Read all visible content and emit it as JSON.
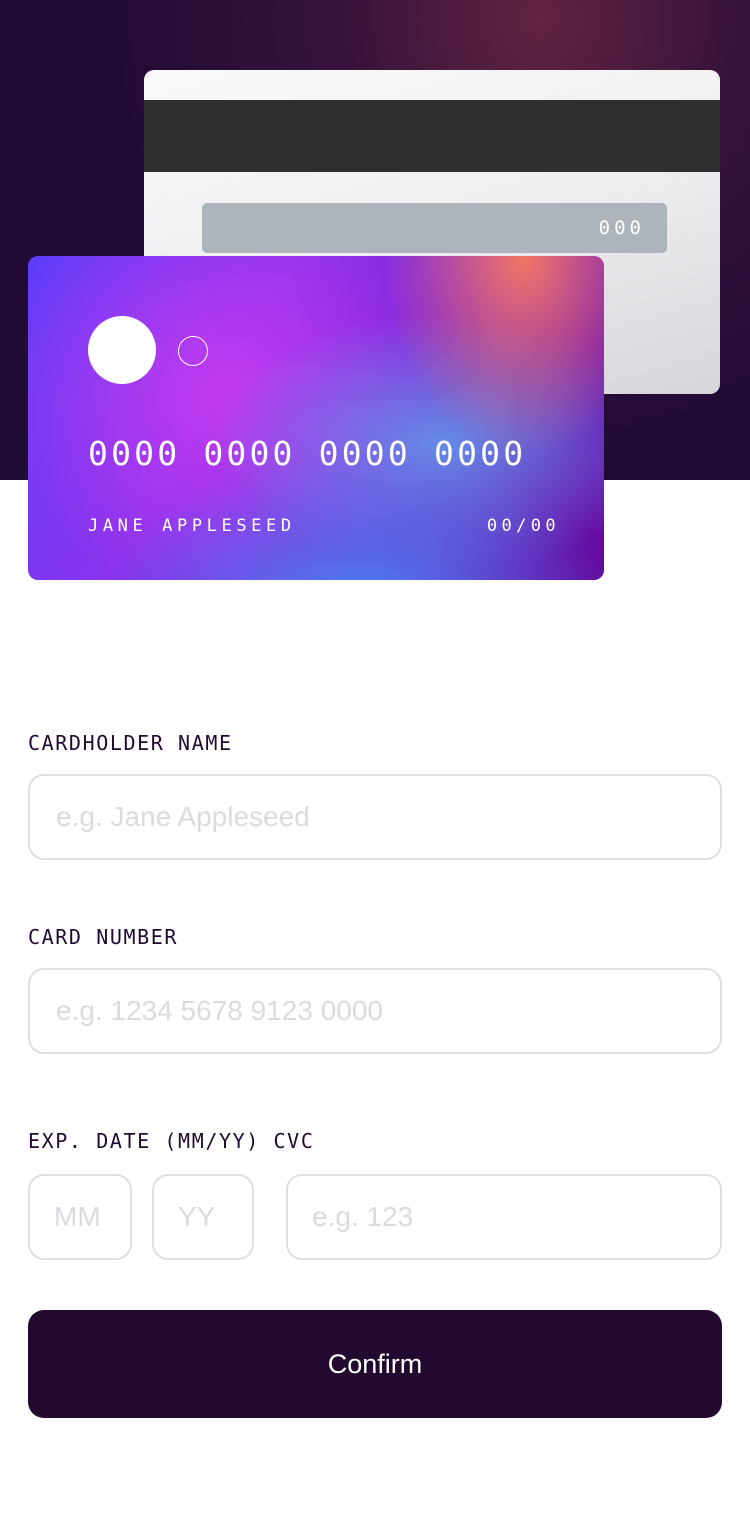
{
  "colors": {
    "hero_background": "#220b33",
    "primary_dark": "#21092f",
    "input_border": "#dfdee0",
    "placeholder": "#dcdadf",
    "cvc_strip": "#adb4bc",
    "mag_stripe": "#2f2f2f"
  },
  "card_back": {
    "cvc": "000"
  },
  "card_front": {
    "number": "0000 0000 0000 0000",
    "holder_name": "JANE APPLESEED",
    "expiry": "00/00"
  },
  "form": {
    "cardholder_label": "CARDHOLDER NAME",
    "cardholder_placeholder": "e.g. Jane Appleseed",
    "card_number_label": "CARD NUMBER",
    "card_number_placeholder": "e.g. 1234 5678 9123 0000",
    "exp_cvc_label": "EXP. DATE (MM/YY) CVC",
    "mm_placeholder": "MM",
    "yy_placeholder": "YY",
    "cvc_placeholder": "e.g. 123",
    "confirm_label": "Confirm"
  }
}
